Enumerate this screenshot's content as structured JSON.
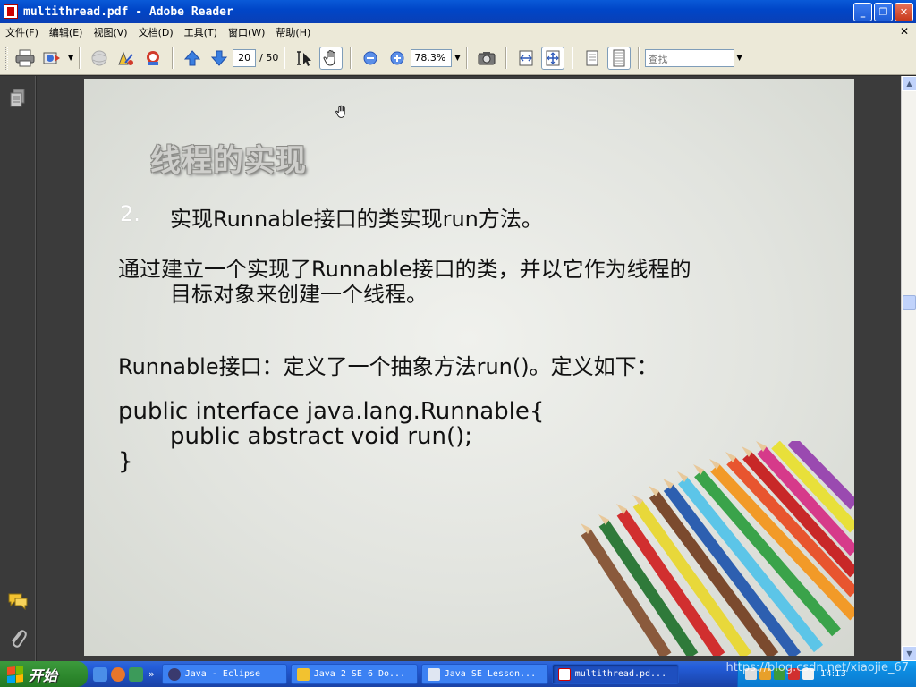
{
  "window": {
    "title": "multithread.pdf - Adobe Reader",
    "controls": {
      "minimize": "_",
      "maximize": "❐",
      "close": "✕"
    }
  },
  "menubar": {
    "items": [
      "文件(F)",
      "编辑(E)",
      "视图(V)",
      "文档(D)",
      "工具(T)",
      "窗口(W)",
      "帮助(H)"
    ],
    "close_glyph": "✕"
  },
  "toolbar": {
    "current_page": "20",
    "total_pages": "/ 50",
    "zoom_value": "78.3%",
    "search_placeholder": "查找",
    "icons": [
      "printer-icon",
      "email-icon",
      "globe-icon",
      "sign-icon",
      "stamp-icon",
      "prev-page-icon",
      "next-page-icon",
      "select-text-icon",
      "hand-tool-icon",
      "zoom-out-icon",
      "zoom-in-icon",
      "snapshot-icon",
      "fit-width-icon",
      "fit-page-icon",
      "single-page-icon",
      "continuous-page-icon"
    ]
  },
  "slide": {
    "title": "线程的实现",
    "item_number": "2.",
    "item_text": "实现Runnable接口的类实现run方法。",
    "paragraph_line1": "通过建立一个实现了Runnable接口的类，并以它作为线程的",
    "paragraph_line2": "目标对象来创建一个线程。",
    "runnable_line": "Runnable接口：定义了一个抽象方法run()。定义如下：",
    "code_line1": "public interface java.lang.Runnable{",
    "code_line2": "public abstract void run();",
    "code_line3": "}"
  },
  "taskbar": {
    "start_label": "开始",
    "quicklaunch_more": "»",
    "tasks": [
      {
        "label": "Java - Eclipse",
        "active": false
      },
      {
        "label": "Java 2 SE 6 Do...",
        "active": false
      },
      {
        "label": "Java SE Lesson...",
        "active": false
      },
      {
        "label": "multithread.pd...",
        "active": true
      }
    ],
    "watermark": "https://blog.csdn.net/xiaojie_67",
    "clock": "14:13"
  }
}
